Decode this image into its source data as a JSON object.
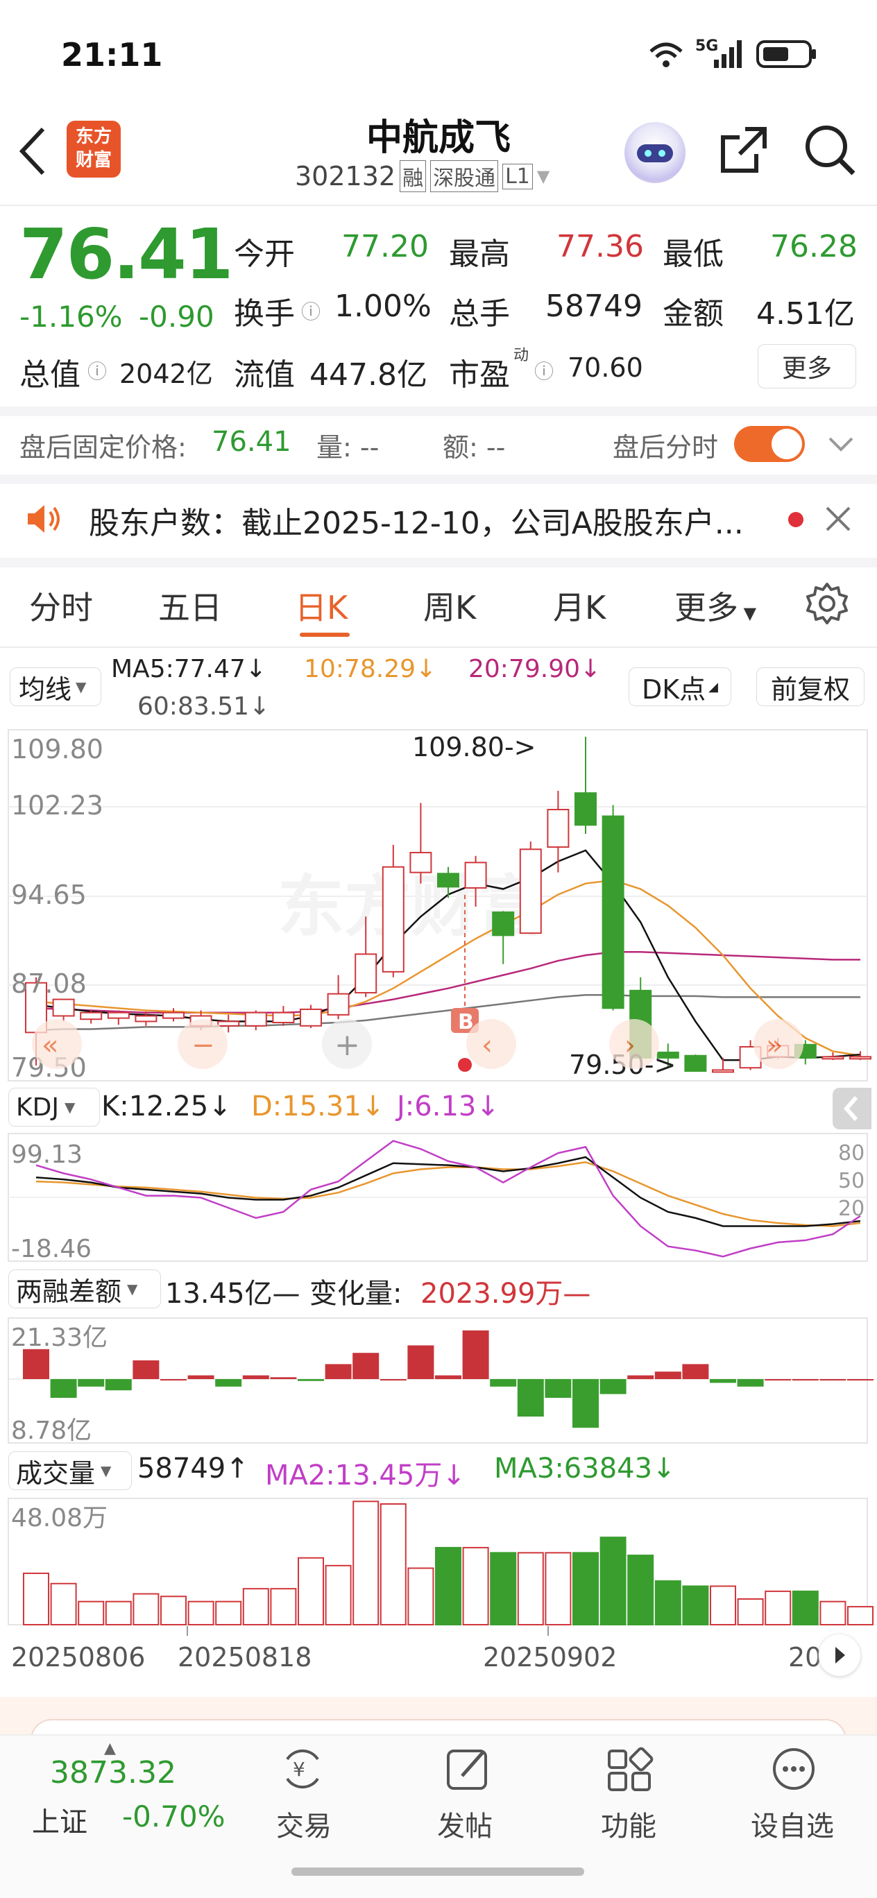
{
  "status": {
    "time": "21:11",
    "network": "5G"
  },
  "header": {
    "logo_line1": "东方",
    "logo_line2": "财富",
    "title": "中航成飞",
    "code": "302132",
    "tag_rong": "融",
    "tag_sgt": "深股通",
    "tag_l1": "L1"
  },
  "quote": {
    "price": "76.41",
    "change_pct": "-1.16%",
    "change": "-0.90",
    "open_label": "今开",
    "open": "77.20",
    "high_label": "最高",
    "high": "77.36",
    "low_label": "最低",
    "low": "76.28",
    "turnover_label": "换手",
    "turnover": "1.00%",
    "volume_label": "总手",
    "volume": "58749",
    "amount_label": "金额",
    "amount": "4.51亿",
    "mktcap_label": "总值",
    "mktcap": "2042亿",
    "float_label": "流值",
    "float": "447.8亿",
    "pe_label": "市盈",
    "pe_sup": "动",
    "pe": "70.60",
    "more": "更多"
  },
  "afterhours": {
    "price_label": "盘后固定价格:",
    "price": "76.41",
    "vol_label": "量: --",
    "amt_label": "额: --",
    "toggle_label": "盘后分时",
    "toggle_on": true
  },
  "notice": {
    "text": "股东户数：截止2025-12-10，公司A股股东户..."
  },
  "tabs": [
    "分时",
    "五日",
    "日K",
    "周K",
    "月K",
    "更多"
  ],
  "active_tab": "日K",
  "ma": {
    "selector": "均线",
    "ma5": "MA5:77.47",
    "ma10": "10:78.29",
    "ma20": "20:79.90",
    "ma60": "60:83.51",
    "dk": "DK点",
    "fq": "前复权"
  },
  "kline": {
    "ymax": "109.80",
    "y2": "102.23",
    "y3": "94.65",
    "y4": "87.08",
    "ymin": "79.50",
    "high_marker": "109.80->",
    "low_marker": "79.50->",
    "signal": "B",
    "colors": {
      "up": "#d0363a",
      "down": "#3a9e2e",
      "ma5": "#111111",
      "ma10": "#e8962e",
      "ma20": "#b8287a",
      "ma60": "#777777"
    }
  },
  "kdj": {
    "selector": "KDJ",
    "k": "K:12.25",
    "d": "D:15.31",
    "j": "J:6.13",
    "ymax": "99.13",
    "ymin": "-18.46",
    "r80": "80",
    "r50": "50",
    "r20": "20"
  },
  "margin": {
    "selector": "两融差额",
    "value": "13.45亿",
    "change_label": "变化量:",
    "change": "2023.99万",
    "ymax": "21.33亿",
    "ymin": "8.78亿"
  },
  "volume": {
    "selector": "成交量",
    "value": "58749",
    "ma2": "MA2:13.45万",
    "ma3": "MA3:63843",
    "ymax": "48.08万"
  },
  "dates": [
    "20250806",
    "20250818",
    "20250902",
    "20"
  ],
  "index": {
    "value": "3873.32",
    "name": "上证",
    "change": "-0.70%"
  },
  "bottom_nav": [
    "交易",
    "发帖",
    "功能",
    "设自选"
  ],
  "chart_data": {
    "type": "candlestick",
    "ohlc": [
      [
        83,
        87.5,
        80,
        88
      ],
      [
        84.5,
        86,
        84,
        86
      ],
      [
        84.2,
        84.8,
        83.8,
        85
      ],
      [
        84.3,
        84.8,
        83.7,
        85
      ],
      [
        84,
        84.5,
        83.6,
        84.9
      ],
      [
        84.3,
        84.8,
        84,
        85.2
      ],
      [
        83.6,
        84.5,
        83.2,
        85
      ],
      [
        83.6,
        84,
        83,
        84.6
      ],
      [
        83.6,
        84.8,
        83.2,
        85
      ],
      [
        83.9,
        84.8,
        83.6,
        85.4
      ],
      [
        83.6,
        85.1,
        83.4,
        85.5
      ],
      [
        84.6,
        86.5,
        84.2,
        88.2
      ],
      [
        86.6,
        90.1,
        86.2,
        93.5
      ],
      [
        88.5,
        98,
        88,
        100
      ],
      [
        97.5,
        99.3,
        96.5,
        103.8
      ],
      [
        97.4,
        96.2,
        95.2,
        98
      ],
      [
        96.1,
        98.4,
        94.4,
        99
      ],
      [
        93.9,
        91.8,
        89.2,
        94
      ],
      [
        92,
        99.6,
        92,
        100.3
      ],
      [
        99.8,
        103.2,
        97.5,
        104.9
      ],
      [
        104.7,
        101.8,
        101,
        109.8
      ],
      [
        102.6,
        85.2,
        85,
        103.6
      ],
      [
        86.8,
        80.7,
        80.5,
        88
      ],
      [
        81.2,
        80.7,
        79.8,
        82
      ],
      [
        80.9,
        79.5,
        79.5,
        81
      ],
      [
        79.5,
        79.6,
        79.5,
        80.7
      ],
      [
        79.8,
        81.7,
        79.6,
        82.3
      ],
      [
        80.8,
        81.8,
        80.6,
        82.5
      ],
      [
        81.9,
        80.7,
        80.1,
        82.3
      ],
      [
        80.8,
        80.8,
        80.5,
        81.2
      ],
      [
        80.8,
        80.8,
        80.5,
        81.3
      ]
    ],
    "ma5": [
      85.5,
      85.2,
      84.9,
      84.7,
      84.6,
      84.5,
      84.2,
      84.0,
      84.0,
      84.0,
      84.5,
      85.5,
      88.0,
      91.0,
      93.5,
      95.5,
      96.5,
      96.0,
      97.0,
      98.5,
      99.5,
      96.5,
      93.0,
      88.0,
      84.0,
      80.5,
      80.5,
      80.8,
      80.7,
      80.8,
      81.0
    ],
    "ma10": [
      85.8,
      85.6,
      85.4,
      85.2,
      85.0,
      84.9,
      84.8,
      84.7,
      84.6,
      84.5,
      84.6,
      85.0,
      85.8,
      87.0,
      88.5,
      90.0,
      91.5,
      92.8,
      94.0,
      95.5,
      96.5,
      96.8,
      96.0,
      94.5,
      92.5,
      90.0,
      87.0,
      84.5,
      82.5,
      81.3,
      80.9
    ],
    "ma20": [
      85.2,
      85.1,
      85.0,
      84.9,
      84.8,
      84.8,
      84.8,
      84.8,
      84.8,
      84.8,
      84.9,
      85.2,
      85.6,
      86.0,
      86.5,
      87.0,
      87.6,
      88.2,
      88.8,
      89.5,
      90.0,
      90.3,
      90.3,
      90.2,
      90.1,
      90.0,
      89.9,
      89.8,
      89.7,
      89.6,
      89.6
    ],
    "ma60": [
      83.2,
      83.3,
      83.3,
      83.4,
      83.5,
      83.5,
      83.5,
      83.6,
      83.6,
      83.7,
      83.8,
      83.9,
      84.1,
      84.4,
      84.7,
      85.0,
      85.3,
      85.6,
      85.9,
      86.2,
      86.4,
      86.4,
      86.3,
      86.3,
      86.3,
      86.2,
      86.2,
      86.2,
      86.2,
      86.2,
      86.2
    ],
    "kdj_k": [
      60,
      58,
      55,
      50,
      48,
      46,
      44,
      40,
      38,
      38,
      42,
      50,
      62,
      74,
      73,
      72,
      70,
      66,
      69,
      74,
      80,
      60,
      40,
      26,
      20,
      12,
      12,
      12,
      12,
      14,
      17
    ],
    "kdj_d": [
      56,
      55,
      53,
      51,
      50,
      48,
      46,
      43,
      40,
      39,
      40,
      45,
      54,
      64,
      68,
      70,
      70,
      68,
      68,
      71,
      75,
      66,
      54,
      42,
      33,
      24,
      18,
      15,
      13,
      12,
      15
    ],
    "kdj_j": [
      72,
      64,
      58,
      50,
      42,
      42,
      40,
      30,
      20,
      26,
      48,
      56,
      76,
      96,
      88,
      76,
      70,
      55,
      70,
      84,
      90,
      42,
      12,
      -8,
      -12,
      -18,
      -10,
      -4,
      -2,
      4,
      22
    ],
    "margin_diff": [
      8,
      -5,
      -2,
      -3,
      5,
      0,
      1,
      -2,
      1,
      0.5,
      -0.5,
      4,
      7,
      0,
      9,
      1,
      13,
      -2,
      -10,
      -5,
      -13,
      -4,
      1,
      2,
      4,
      -1,
      -2,
      0,
      0,
      0,
      0
    ],
    "volume": [
      20,
      16,
      9,
      9,
      12,
      11,
      9,
      9,
      14,
      14,
      26,
      23,
      48,
      47,
      22,
      30,
      30,
      28,
      28,
      28,
      28,
      34,
      27,
      17,
      15,
      15,
      10,
      13,
      13,
      9,
      7,
      7
    ],
    "x_dates": [
      "20250806",
      "20250818",
      "20250902"
    ]
  }
}
